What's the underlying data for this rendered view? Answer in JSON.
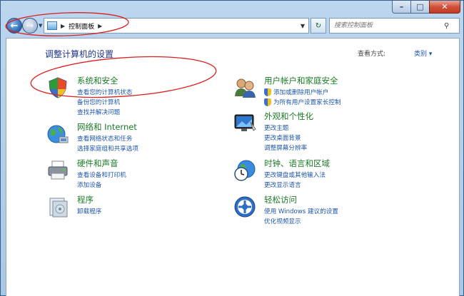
{
  "window": {
    "caption": {
      "minimize": "–",
      "maximize": "□",
      "close": "✕"
    }
  },
  "toolbar": {
    "back_icon": "back-arrow-icon",
    "forward_icon": "forward-arrow-icon",
    "address": {
      "crumbs": [
        "控制面板"
      ]
    },
    "search": {
      "placeholder": "搜索控制面板"
    }
  },
  "header": {
    "title": "调整计算机的设置",
    "view_by_label": "查看方式:",
    "view_by_value": "类别"
  },
  "categories": [
    {
      "title": "系统和安全",
      "icon": "system-security-icon",
      "links": [
        {
          "label": "查看您的计算机状态",
          "shield": false
        },
        {
          "label": "备份您的计算机",
          "shield": false
        },
        {
          "label": "查找并解决问题",
          "shield": false
        }
      ]
    },
    {
      "title": "网络和 Internet",
      "icon": "network-globe-icon",
      "links": [
        {
          "label": "查看网络状态和任务",
          "shield": false
        },
        {
          "label": "选择家庭组和共享选项",
          "shield": false
        }
      ]
    },
    {
      "title": "硬件和声音",
      "icon": "printer-hardware-icon",
      "links": [
        {
          "label": "查看设备和打印机",
          "shield": false
        },
        {
          "label": "添加设备",
          "shield": false
        }
      ]
    },
    {
      "title": "程序",
      "icon": "programs-icon",
      "links": [
        {
          "label": "卸载程序",
          "shield": false
        }
      ]
    },
    {
      "title": "用户帐户和家庭安全",
      "icon": "user-accounts-icon",
      "links": [
        {
          "label": "添加或删除用户帐户",
          "shield": true
        },
        {
          "label": "为所有用户设置家长控制",
          "shield": true
        }
      ]
    },
    {
      "title": "外观和个性化",
      "icon": "appearance-monitor-icon",
      "links": [
        {
          "label": "更改主题",
          "shield": false
        },
        {
          "label": "更改桌面背景",
          "shield": false
        },
        {
          "label": "调整屏幕分辨率",
          "shield": false
        }
      ]
    },
    {
      "title": "时钟、语言和区域",
      "icon": "clock-globe-icon",
      "links": [
        {
          "label": "更改键盘或其他输入法",
          "shield": false
        },
        {
          "label": "更改显示语言",
          "shield": false
        }
      ]
    },
    {
      "title": "轻松访问",
      "icon": "ease-of-access-icon",
      "links": [
        {
          "label": "使用 Windows 建议的设置",
          "shield": false
        },
        {
          "label": "优化视频显示",
          "shield": false
        }
      ]
    }
  ],
  "colors": {
    "category_title": "#1b7a26",
    "link": "#1e56a8",
    "page_title": "#1e3287",
    "annotation": "#d92020"
  }
}
